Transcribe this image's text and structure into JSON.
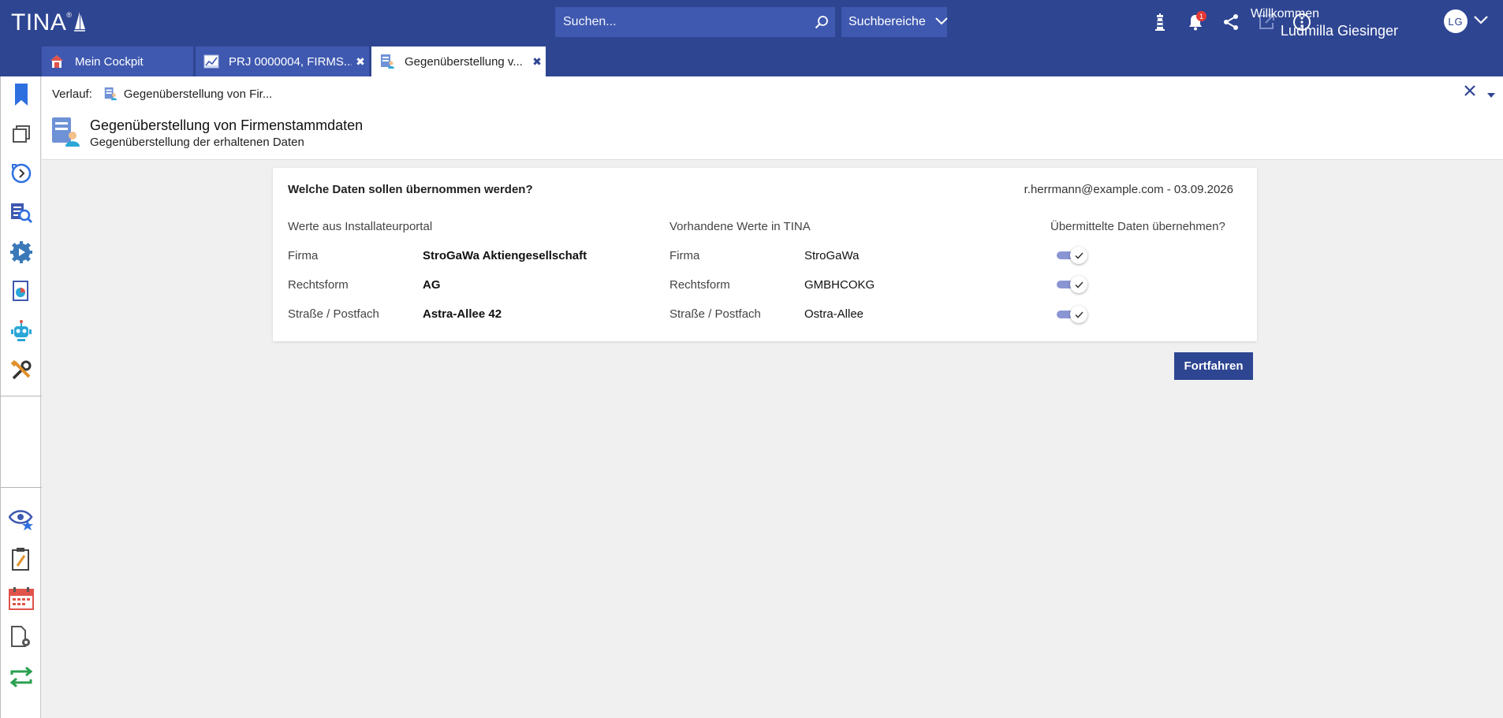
{
  "app": {
    "logo_text": "TINA",
    "logo_mark": "®"
  },
  "search": {
    "placeholder": "Suchen...",
    "scope_label": "Suchbereiche"
  },
  "header": {
    "notification_count": "1",
    "welcome_label": "Willkommen",
    "user_name": "Ludmilla Giesinger",
    "avatar_initials": "LG",
    "icons": [
      "lighthouse-icon",
      "bell-icon",
      "share-icon",
      "external-link-icon",
      "more-icon"
    ]
  },
  "tabs": [
    {
      "label": "Mein Cockpit",
      "icon": "home-icon"
    },
    {
      "label": "PRJ 0000004, FIRMS...",
      "icon": "project-chart-icon",
      "close": "✖"
    },
    {
      "label": "Gegenüberstellung v...",
      "icon": "form-person-icon",
      "close": "✖"
    }
  ],
  "breadcrumb": {
    "label": "Verlauf:",
    "item": "Gegenüberstellung von Fir..."
  },
  "page": {
    "title": "Gegenüberstellung von Firmenstammdaten",
    "subtitle": "Gegenüberstellung der erhaltenen Daten"
  },
  "card": {
    "question": "Welche Daten sollen übernommen werden?",
    "meta": "r.herrmann@example.com - 03.09.2026",
    "col_portal": "Werte aus Installateurportal",
    "col_tina": "Vorhandene Werte in TINA",
    "col_take": "Übermittelte Daten übernehmen?",
    "rows": [
      {
        "label": "Firma",
        "portal_value": "StroGaWa Aktiengesellschaft",
        "tina_label": "Firma",
        "tina_value": "StroGaWa",
        "take": true
      },
      {
        "label": "Rechtsform",
        "portal_value": "AG",
        "tina_label": "Rechtsform",
        "tina_value": "GMBHCOKG",
        "take": true
      },
      {
        "label": "Straße / Postfach",
        "portal_value": "Astra-Allee 42",
        "tina_label": "Straße / Postfach",
        "tina_value": "Ostra-Allee",
        "take": true
      }
    ]
  },
  "actions": {
    "continue_label": "Fortfahren"
  },
  "colors": {
    "brand": "#2e4592",
    "brand_light": "#3f59b0",
    "toggle_on": "#8a96d4",
    "badge": "#e53935"
  }
}
